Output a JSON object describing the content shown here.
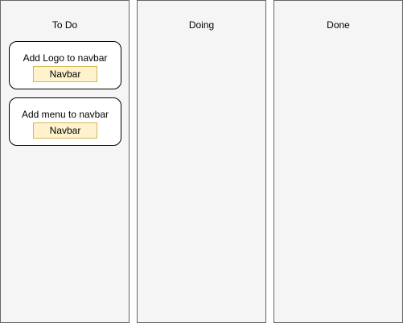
{
  "board": {
    "columns": [
      {
        "title": "To Do",
        "cards": [
          {
            "title": "Add Logo to navbar",
            "tag": "Navbar"
          },
          {
            "title": "Add menu to navbar",
            "tag": "Navbar"
          }
        ]
      },
      {
        "title": "Doing",
        "cards": []
      },
      {
        "title": "Done",
        "cards": []
      }
    ]
  },
  "colors": {
    "column_fill": "#f5f5f5",
    "column_border": "#666666",
    "card_fill": "#ffffff",
    "card_border": "#000000",
    "tag_fill": "#fff2cc",
    "tag_border": "#d6b656"
  }
}
